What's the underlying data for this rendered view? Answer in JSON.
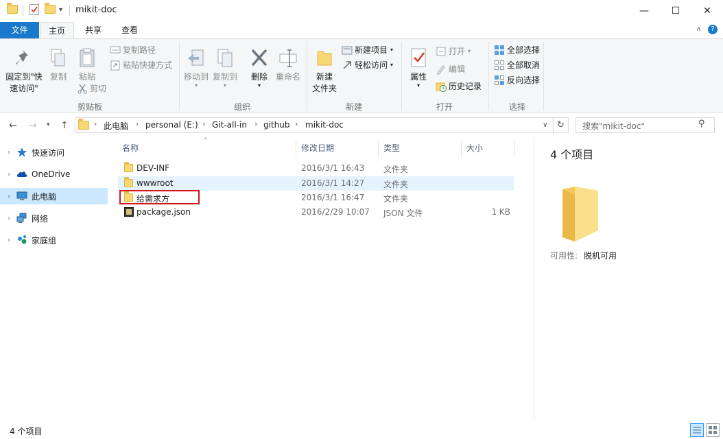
{
  "window": {
    "title": "mikit-doc",
    "minimize": "—",
    "maximize": "☐",
    "close": "✕"
  },
  "ribbon_tabs": [
    "文件",
    "主页",
    "共享",
    "查看"
  ],
  "ribbon": {
    "clipboard": {
      "pin_label_1": "固定到\"快",
      "pin_label_2": "速访问\"",
      "copy": "复制",
      "paste": "粘贴",
      "copy_path": "复制路径",
      "paste_shortcut": "粘贴快捷方式",
      "cut": "剪切",
      "group": "剪贴板"
    },
    "organize": {
      "move_to": "移动到",
      "copy_to": "复制到",
      "delete": "删除",
      "rename": "重命名",
      "group": "组织"
    },
    "new": {
      "new_folder_1": "新建",
      "new_folder_2": "文件夹",
      "new_item": "新建项目",
      "easy_access": "轻松访问",
      "group": "新建"
    },
    "open": {
      "properties": "属性",
      "open": "打开",
      "edit": "编辑",
      "history": "历史记录",
      "group": "打开"
    },
    "select": {
      "select_all": "全部选择",
      "select_none": "全部取消",
      "invert": "反向选择",
      "group": "选择"
    }
  },
  "address": {
    "crumbs": [
      "此电脑",
      "personal (E:)",
      "Git-all-in",
      "github",
      "mikit-doc"
    ],
    "search_placeholder": "搜索\"mikit-doc\""
  },
  "sidebar": {
    "items": [
      {
        "label": "快速访问",
        "icon": "star-icon"
      },
      {
        "label": "OneDrive",
        "icon": "cloud-icon"
      },
      {
        "label": "此电脑",
        "icon": "computer-icon"
      },
      {
        "label": "网络",
        "icon": "network-icon"
      },
      {
        "label": "家庭组",
        "icon": "homegroup-icon"
      }
    ]
  },
  "columns": {
    "name": "名称",
    "modified": "修改日期",
    "type": "类型",
    "size": "大小"
  },
  "files": [
    {
      "name": "DEV-INF",
      "modified": "2016/3/1 16:43",
      "type": "文件夹",
      "size": ""
    },
    {
      "name": "wwwroot",
      "modified": "2016/3/1 14:27",
      "type": "文件夹",
      "size": ""
    },
    {
      "name": "给需求方",
      "modified": "2016/3/1 16:47",
      "type": "文件夹",
      "size": ""
    },
    {
      "name": "package.json",
      "modified": "2016/2/29 10:07",
      "type": "JSON 文件",
      "size": "1 KB"
    }
  ],
  "details": {
    "count": "4 个项目",
    "availability_label": "可用性:",
    "availability_value": "脱机可用"
  },
  "status": {
    "text": "4 个项目"
  },
  "colors": {
    "accent": "#1979ca",
    "selection": "#cce8ff",
    "highlight_box": "#d4131a",
    "folder": "#f8d775"
  }
}
